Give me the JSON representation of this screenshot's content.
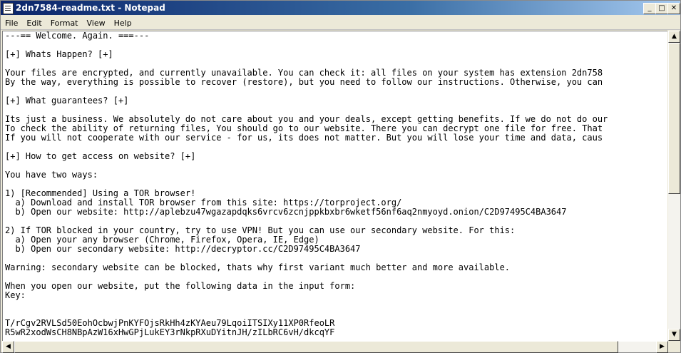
{
  "window": {
    "title": "2dn7584-readme.txt - Notepad",
    "controls": {
      "minimize": "_",
      "maximize": "□",
      "close": "✕"
    }
  },
  "menu": [
    "File",
    "Edit",
    "Format",
    "View",
    "Help"
  ],
  "document": {
    "lines": [
      "---== Welcome. Again. ===---",
      "",
      "[+] Whats Happen? [+]",
      "",
      "Your files are encrypted, and currently unavailable. You can check it: all files on your system has extension 2dn758",
      "By the way, everything is possible to recover (restore), but you need to follow our instructions. Otherwise, you can",
      "",
      "[+] What guarantees? [+]",
      "",
      "Its just a business. We absolutely do not care about you and your deals, except getting benefits. If we do not do our",
      "To check the ability of returning files, You should go to our website. There you can decrypt one file for free. That",
      "If you will not cooperate with our service - for us, its does not matter. But you will lose your time and data, caus",
      "",
      "[+] How to get access on website? [+]",
      "",
      "You have two ways:",
      "",
      "1) [Recommended] Using a TOR browser!",
      "  a) Download and install TOR browser from this site: https://torproject.org/",
      "  b) Open our website: http://aplebzu47wgazapdqks6vrcv6zcnjppkbxbr6wketf56nf6aq2nmyoyd.onion/C2D97495C4BA3647",
      "",
      "2) If TOR blocked in your country, try to use VPN! But you can use our secondary website. For this:",
      "  a) Open your any browser (Chrome, Firefox, Opera, IE, Edge)",
      "  b) Open our secondary website: http://decryptor.cc/C2D97495C4BA3647",
      "",
      "Warning: secondary website can be blocked, thats why first variant much better and more available.",
      "",
      "When you open our website, put the following data in the input form:",
      "Key:",
      "",
      "",
      "T/rCgv2RVLSd50EohOcbwjPnKYFOjsRkHh4zKYAeu79LqoiITSIXy11XP0RfeoLR",
      "R5wR2xodWsCH8NBpAzW16xHwGPjLukEY3rNkpRXuDYitnJH/zILbRC6vH/dkcqYF"
    ]
  },
  "scrollbars": {
    "vertical": {
      "up": "▲",
      "down": "▼"
    },
    "horizontal": {
      "left": "◀",
      "right": "▶"
    }
  }
}
